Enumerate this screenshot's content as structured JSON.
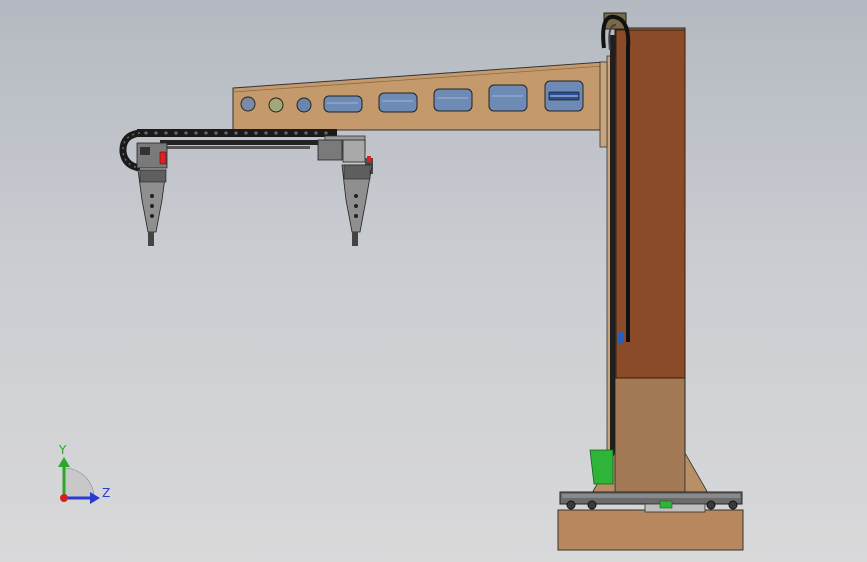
{
  "viewport": {
    "background_top": "#b4b9c1",
    "background_bottom": "#d9d9da"
  },
  "triad": {
    "y_label": "Y",
    "z_label": "Z",
    "y_color": "#2aa82a",
    "z_color": "#2a3bd0",
    "x_color": "#d42020"
  },
  "model": {
    "arm_color": "#c49a6c",
    "column_color": "#a37a55",
    "column_panel_color": "#8b4b28",
    "base_color": "#b7875e",
    "cable_chain_color": "#1a1a1a",
    "green_plate_color": "#2fb43a",
    "blue_accent_color": "#2b5fb7"
  }
}
